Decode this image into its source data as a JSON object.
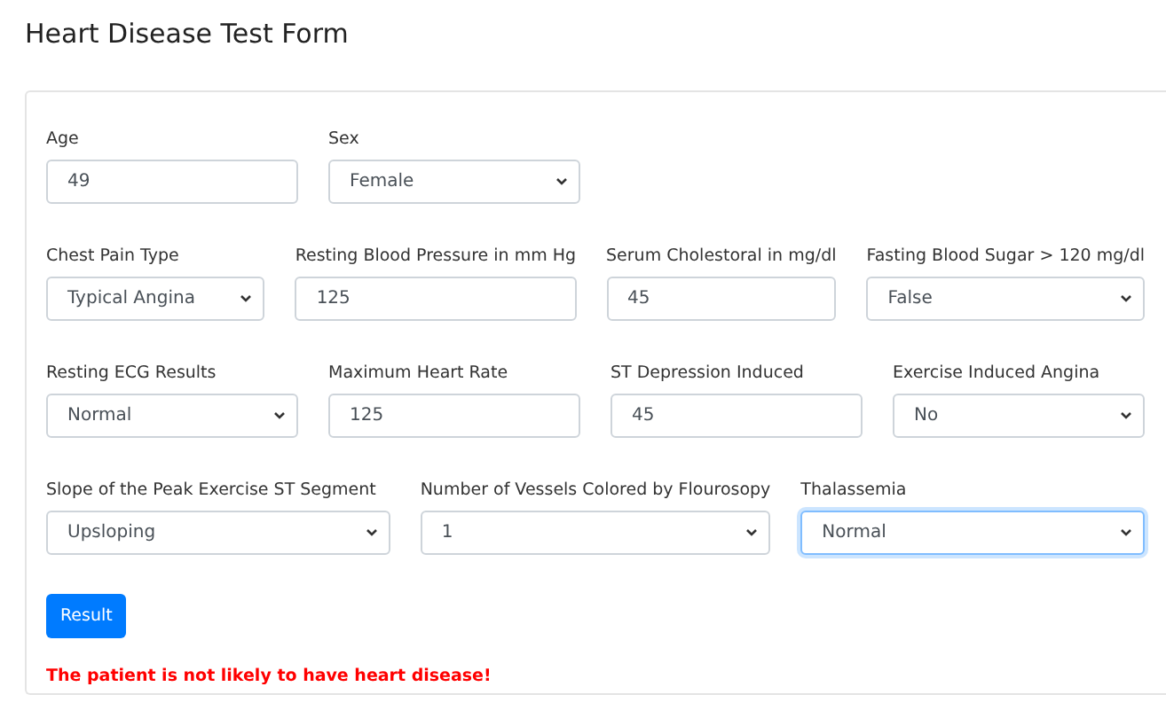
{
  "title": "Heart Disease Test Form",
  "rows": [
    {
      "fields": [
        {
          "label": "Age",
          "kind": "input",
          "value": "49",
          "focused": false
        },
        {
          "label": "Sex",
          "kind": "select",
          "value": "Female",
          "focused": false
        }
      ]
    },
    {
      "fields": [
        {
          "label": "Chest Pain Type",
          "kind": "select",
          "value": "Typical Angina",
          "focused": false
        },
        {
          "label": "Resting Blood Pressure in mm Hg",
          "kind": "input",
          "value": "125",
          "focused": false
        },
        {
          "label": "Serum Cholestoral in mg/dl",
          "kind": "input",
          "value": "45",
          "focused": false
        },
        {
          "label": "Fasting Blood Sugar > 120 mg/dl",
          "kind": "select",
          "value": "False",
          "focused": false
        }
      ]
    },
    {
      "fields": [
        {
          "label": "Resting ECG Results",
          "kind": "select",
          "value": "Normal",
          "focused": false
        },
        {
          "label": "Maximum Heart Rate",
          "kind": "input",
          "value": "125",
          "focused": false
        },
        {
          "label": "ST Depression Induced",
          "kind": "input",
          "value": "45",
          "focused": false
        },
        {
          "label": "Exercise Induced Angina",
          "kind": "select",
          "value": "No",
          "focused": false
        }
      ]
    },
    {
      "fields": [
        {
          "label": "Slope of the Peak Exercise ST Segment",
          "kind": "select",
          "value": "Upsloping",
          "focused": false
        },
        {
          "label": "Number of Vessels Colored by Flourosopy",
          "kind": "select",
          "value": "1",
          "focused": false
        },
        {
          "label": "Thalassemia",
          "kind": "select",
          "value": "Normal",
          "focused": true
        }
      ]
    }
  ],
  "button": "Result",
  "message": "The patient is not likely to have heart disease!"
}
